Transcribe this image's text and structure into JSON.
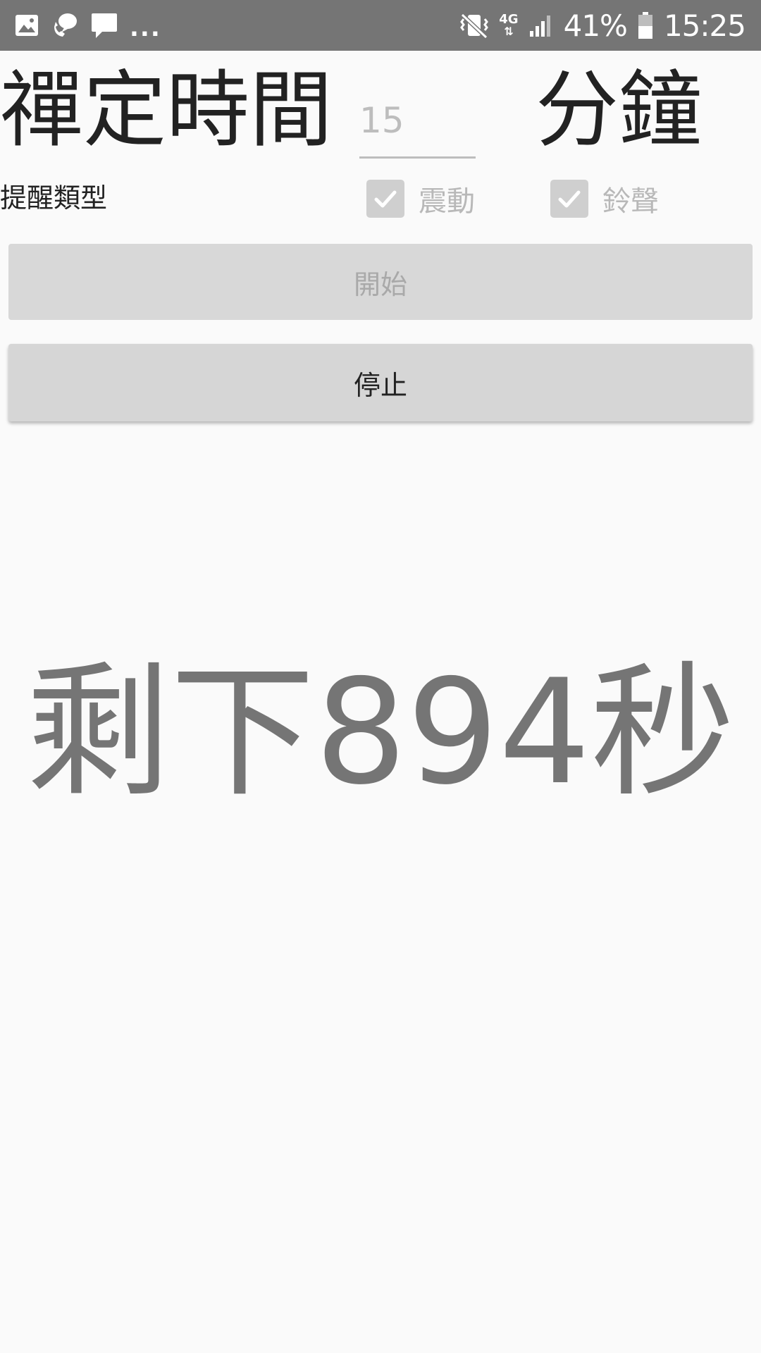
{
  "status_bar": {
    "left_icons": [
      "gallery-icon",
      "call-message-icon",
      "chat-icon"
    ],
    "more_indicator": "...",
    "network": "4G",
    "battery_percent": "41%",
    "time": "15:25",
    "icons": [
      "mute-vibrate-icon",
      "signal-icon",
      "battery-icon"
    ]
  },
  "timer": {
    "title": "禪定時間",
    "minutes_value": "15",
    "unit": "分鐘"
  },
  "reminder": {
    "label": "提醒類型",
    "options": [
      {
        "label": "震動",
        "checked": true,
        "enabled": false
      },
      {
        "label": "鈴聲",
        "checked": true,
        "enabled": false
      }
    ]
  },
  "buttons": {
    "start": {
      "label": "開始",
      "enabled": false
    },
    "stop": {
      "label": "停止",
      "enabled": true
    }
  },
  "countdown": {
    "text": "剩下894秒",
    "seconds_remaining": 894
  },
  "colors": {
    "status_bar": "#757575",
    "background": "#fafafa",
    "countdown_text": "#757575",
    "disabled_text": "#bdbdbd"
  }
}
